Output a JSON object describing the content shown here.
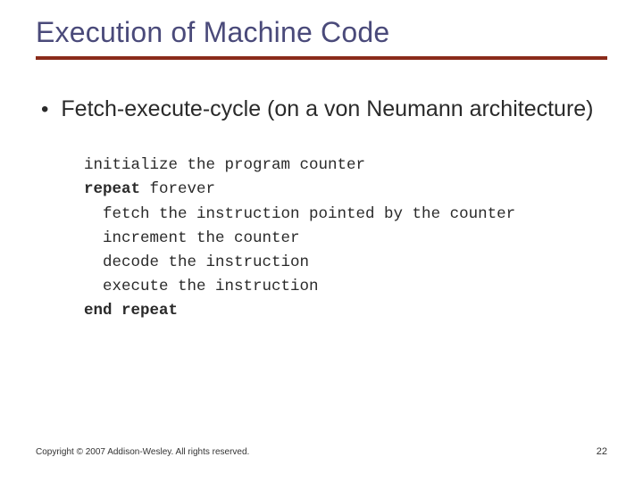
{
  "title": "Execution of Machine Code",
  "bullet": {
    "marker": "•",
    "text": "Fetch-execute-cycle (on a von Neumann architecture)"
  },
  "code": {
    "l1": "initialize the program counter",
    "l2a": "repeat",
    "l2b": " forever",
    "l3": "  fetch the instruction pointed by the counter",
    "l4": "  increment the counter",
    "l5": "  decode the instruction",
    "l6": "  execute the instruction",
    "l7": "end repeat"
  },
  "footer": "Copyright © 2007 Addison-Wesley. All rights reserved.",
  "page_number": "22"
}
